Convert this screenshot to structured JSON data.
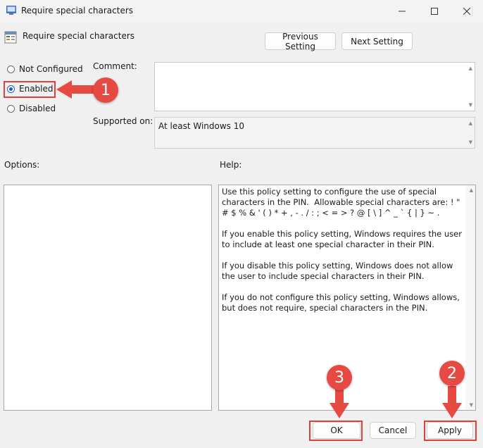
{
  "window": {
    "title": "Require special characters",
    "minimize_icon": "minimize-icon",
    "maximize_icon": "maximize-icon",
    "close_icon": "close-icon"
  },
  "header": {
    "policy_name": "Require special characters",
    "previous_setting_label": "Previous Setting",
    "next_setting_label": "Next Setting"
  },
  "state": {
    "options": [
      {
        "label": "Not Configured",
        "selected": false
      },
      {
        "label": "Enabled",
        "selected": true
      },
      {
        "label": "Disabled",
        "selected": false
      }
    ]
  },
  "comment": {
    "label": "Comment:",
    "value": ""
  },
  "supported": {
    "label": "Supported on:",
    "value": "At least Windows 10"
  },
  "options_panel": {
    "label": "Options:"
  },
  "help_panel": {
    "label": "Help:",
    "text": "Use this policy setting to configure the use of special characters in the PIN.  Allowable special characters are: ! \" # $ % & ' ( ) * + , - . / : ; < = > ? @ [ \\ ] ^ _ ` { | } ~ .\n\nIf you enable this policy setting, Windows requires the user to include at least one special character in their PIN.\n\nIf you disable this policy setting, Windows does not allow the user to include special characters in their PIN.\n\nIf you do not configure this policy setting, Windows allows, but does not require, special characters in the PIN."
  },
  "footer": {
    "ok_label": "OK",
    "cancel_label": "Cancel",
    "apply_label": "Apply"
  },
  "annotations": {
    "step1": "1",
    "step2": "2",
    "step3": "3",
    "accent": "#e74a43"
  }
}
